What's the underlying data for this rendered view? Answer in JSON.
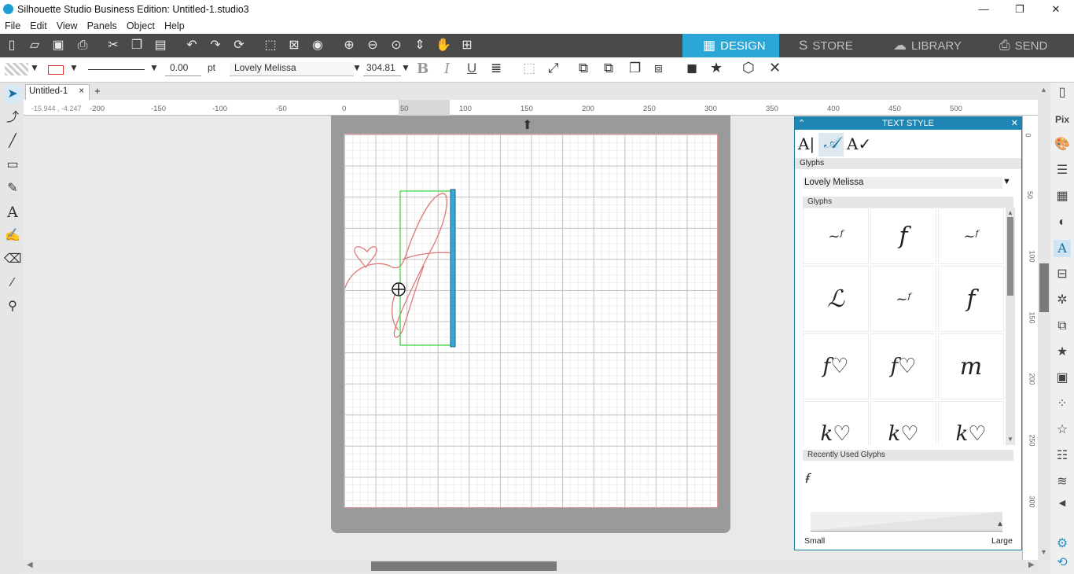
{
  "window": {
    "title": "Silhouette Studio Business Edition: Untitled-1.studio3",
    "minimize": "—",
    "maximize": "❐",
    "close": "✕"
  },
  "menu": [
    "File",
    "Edit",
    "View",
    "Panels",
    "Object",
    "Help"
  ],
  "tabs": [
    {
      "label": "DESIGN",
      "icon": "▦"
    },
    {
      "label": "STORE",
      "icon": "S"
    },
    {
      "label": "LIBRARY",
      "icon": "☁"
    },
    {
      "label": "SEND",
      "icon": "⎙"
    }
  ],
  "toolbar2": {
    "line_width": "0.00",
    "unit": "pt",
    "font_name": "Lovely Melissa",
    "font_size": "304.81",
    "bold": "B",
    "italic": "I",
    "underline": "U"
  },
  "document": {
    "tab_label": "Untitled-1",
    "close": "×",
    "add": "+",
    "coords": "-15.944 , -4.247"
  },
  "ruler": {
    "h": [
      "-200",
      "-150",
      "-100",
      "-50",
      "0",
      "50",
      "100",
      "150",
      "200",
      "250",
      "300",
      "350",
      "400",
      "450",
      "500"
    ],
    "v": [
      "0",
      "50",
      "100",
      "150",
      "200",
      "250",
      "300"
    ]
  },
  "panel": {
    "title": "TEXT STYLE",
    "section_glyphs": "Glyphs",
    "font": "Lovely Melissa",
    "glyphs_label": "Glyphs",
    "recent_label": "Recently Used Glyphs",
    "recent_glyph": "ꞙ",
    "small": "Small",
    "large": "Large",
    "glyphs": [
      "~ᶠ",
      "f",
      "~ᶠ",
      "ℒ",
      "~ᶠ",
      "f",
      "f♡",
      "f♡",
      "m",
      "k♡",
      "k♡",
      "k♡"
    ]
  }
}
